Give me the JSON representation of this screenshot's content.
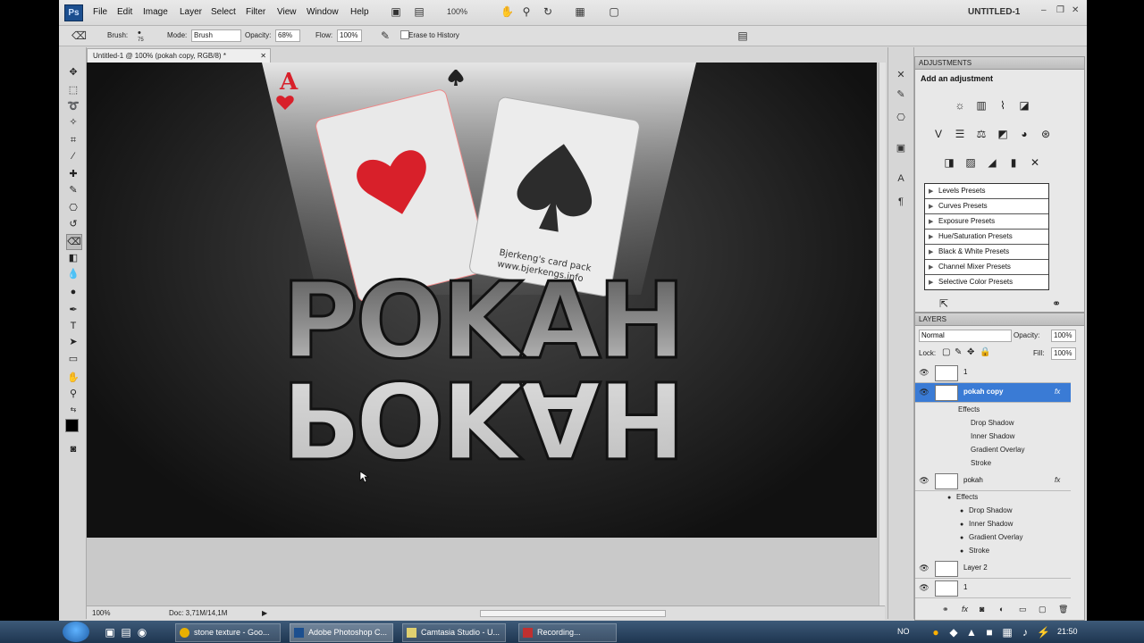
{
  "app": {
    "logo": "Ps",
    "doc_title": "UNTITLED-1",
    "zoom": "100%"
  },
  "menu": [
    "File",
    "Edit",
    "Image",
    "Layer",
    "Select",
    "Filter",
    "View",
    "Window",
    "Help"
  ],
  "options": {
    "brush_label": "Brush:",
    "brush_size": "75",
    "mode_label": "Mode:",
    "mode_value": "Brush",
    "opacity_label": "Opacity:",
    "opacity_value": "68%",
    "flow_label": "Flow:",
    "flow_value": "100%",
    "erase_label": "Erase to History"
  },
  "document": {
    "tab": "Untitled-1 @ 100% (pokah copy, RGB/8) *",
    "status_zoom": "100%",
    "status_doc": "Doc: 3,71M/14,1M",
    "canvas_text": {
      "top": "POKAH",
      "bottom": "POKAH",
      "card_line1": "Bjerkeng's card pack",
      "card_line2": "www.bjerkengs.info"
    }
  },
  "adjustments": {
    "tab": "ADJUSTMENTS",
    "title": "Add an adjustment",
    "presets": [
      "Levels Presets",
      "Curves Presets",
      "Exposure Presets",
      "Hue/Saturation Presets",
      "Black & White Presets",
      "Channel Mixer Presets",
      "Selective Color Presets"
    ]
  },
  "layers": {
    "tab": "LAYERS",
    "blend_mode": "Normal",
    "opacity_label": "Opacity:",
    "opacity_value": "100%",
    "lock_label": "Lock:",
    "fill_label": "Fill:",
    "fill_value": "100%",
    "items": [
      {
        "name": "1",
        "fx": ""
      },
      {
        "name": "pokah copy",
        "fx": "fx"
      },
      {
        "name": "pokah",
        "fx": "fx"
      },
      {
        "name": "Layer 2",
        "fx": ""
      },
      {
        "name": "1",
        "fx": ""
      }
    ],
    "effects_label": "Effects",
    "effects": [
      "Drop Shadow",
      "Inner Shadow",
      "Gradient Overlay",
      "Stroke"
    ]
  },
  "taskbar": {
    "tasks": [
      "stone texture - Goo...",
      "Adobe Photoshop C...",
      "Camtasia Studio - U...",
      "Recording..."
    ],
    "lang": "NO",
    "clock": "21:50"
  },
  "colors": {
    "accent": "#3a7bd5",
    "canvas_dark": "#1a1a1a",
    "taskbar": "#1e3550"
  }
}
